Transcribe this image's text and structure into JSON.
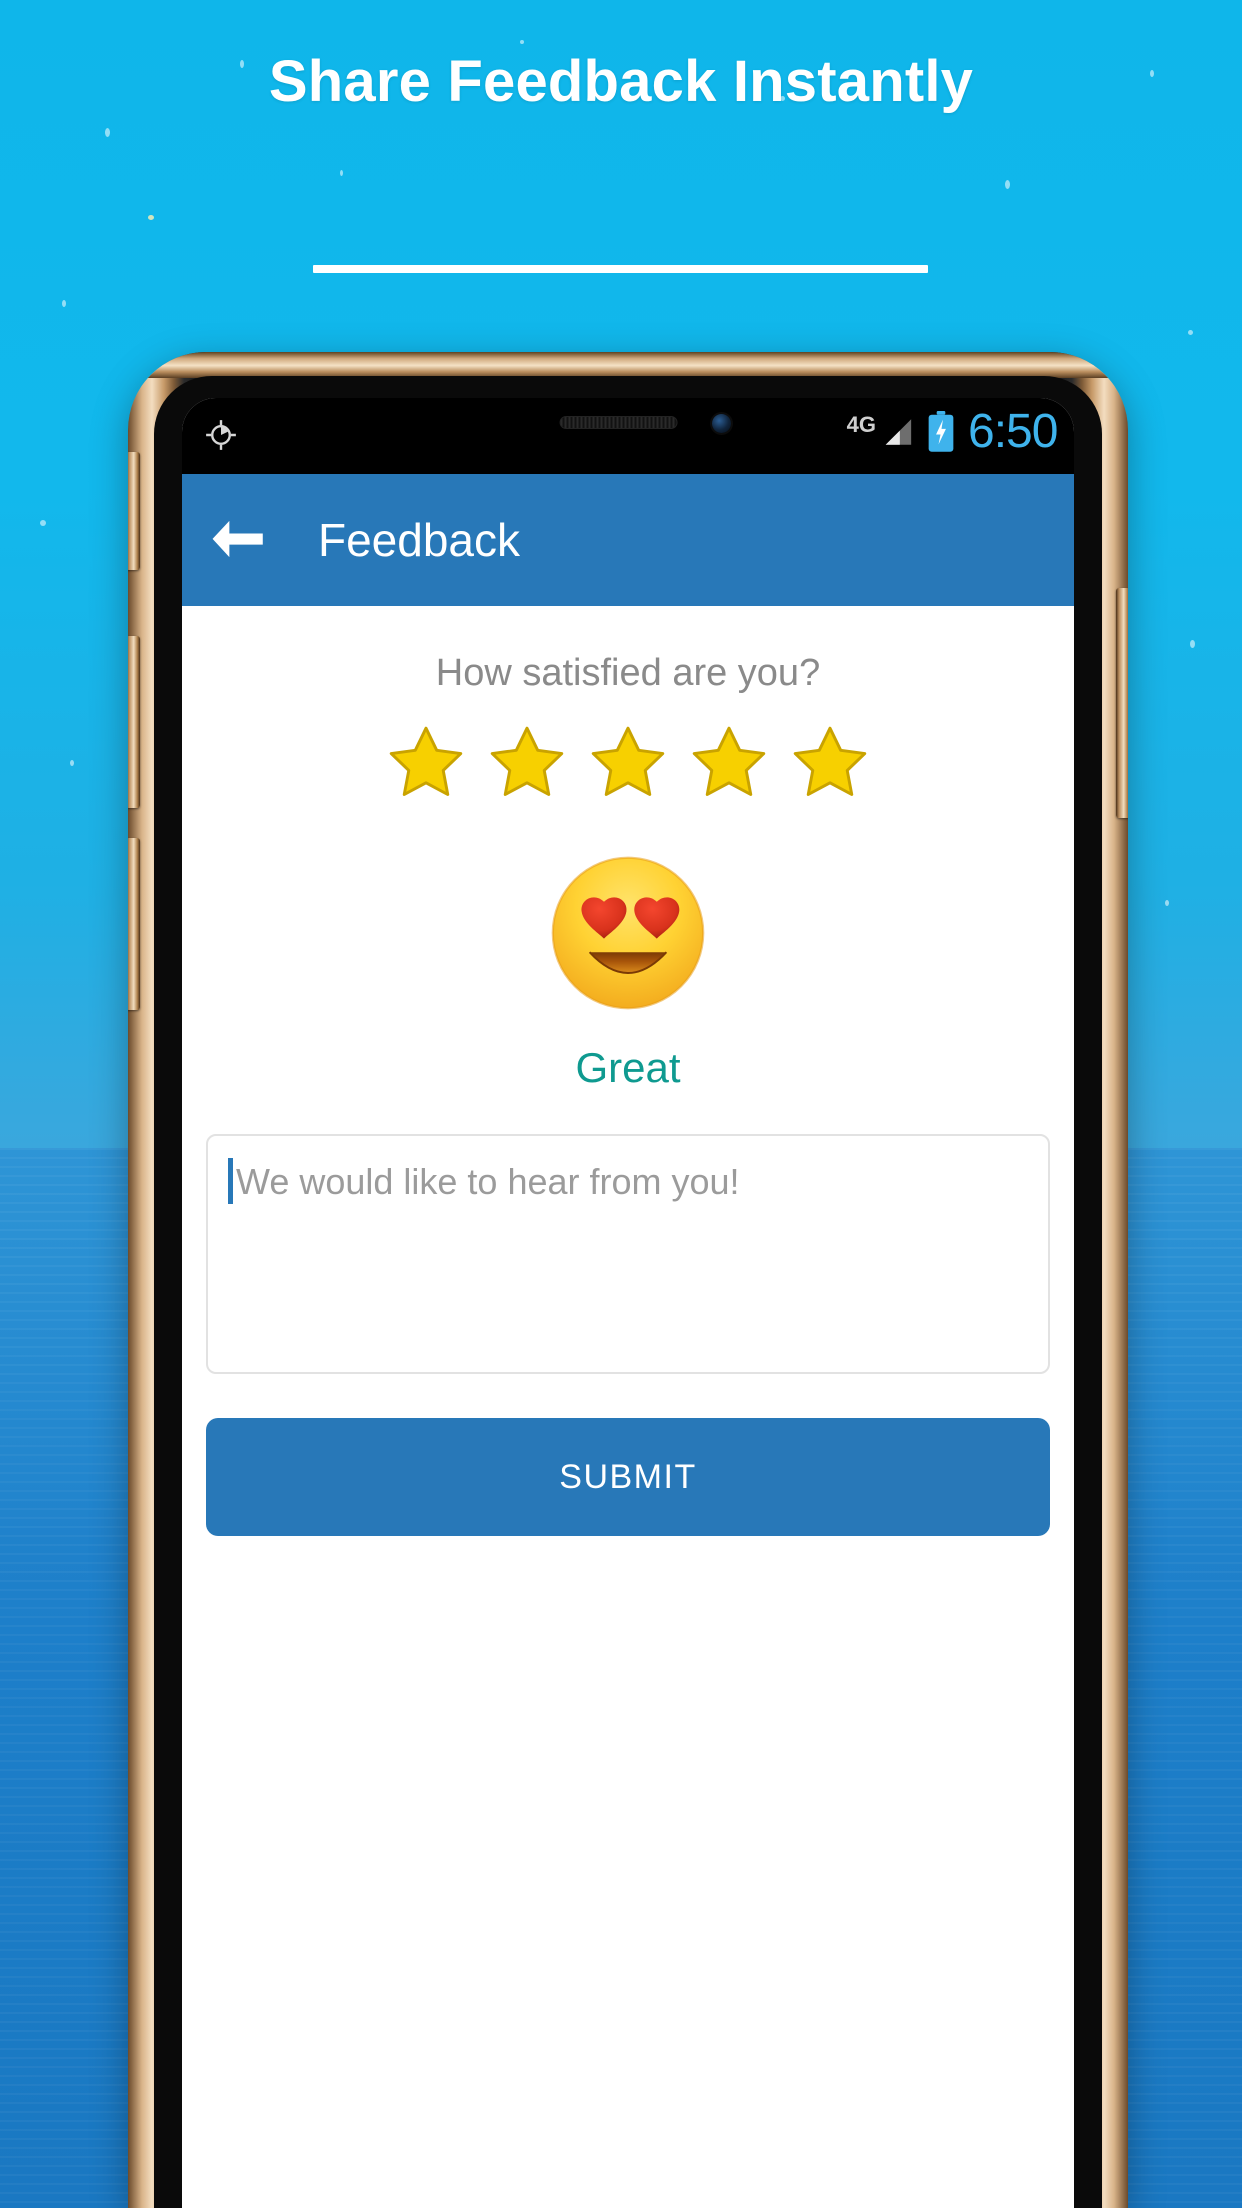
{
  "promo": {
    "headline": "Share Feedback Instantly",
    "rule": "divider"
  },
  "colors": {
    "sky": "#11b5e8",
    "ocean": "#1a78c2",
    "appbar_blue": "#2878b8",
    "submit_blue": "#2878b8",
    "mood_teal": "#0f9a90",
    "star_gold": "#F7D000",
    "placeholder_gray": "#9b9b9b",
    "question_gray": "#8a8a8a",
    "caret_blue": "#2878b8",
    "bezel_gold": "#f3ddc0"
  },
  "phone": {
    "statusbar": {
      "gps_icon": "location-icon",
      "network_type": "4G",
      "signal_icon": "signal-bars-icon",
      "battery_icon": "battery-charging-icon",
      "clock": "6:50"
    },
    "appbar": {
      "back_icon": "back-arrow-icon",
      "title": "Feedback"
    },
    "screen": {
      "question": "How satisfied are you?",
      "rating": {
        "icon": "star-icon",
        "total": 5,
        "selected": 5,
        "stars": [
          "star-1",
          "star-2",
          "star-3",
          "star-4",
          "star-5"
        ]
      },
      "emoji": {
        "name": "heart-eyes-emoji",
        "glyph": "😍"
      },
      "mood_label": "Great",
      "comment": {
        "value": "",
        "placeholder": "We would like to hear from you!"
      },
      "submit_label": "SUBMIT"
    }
  }
}
